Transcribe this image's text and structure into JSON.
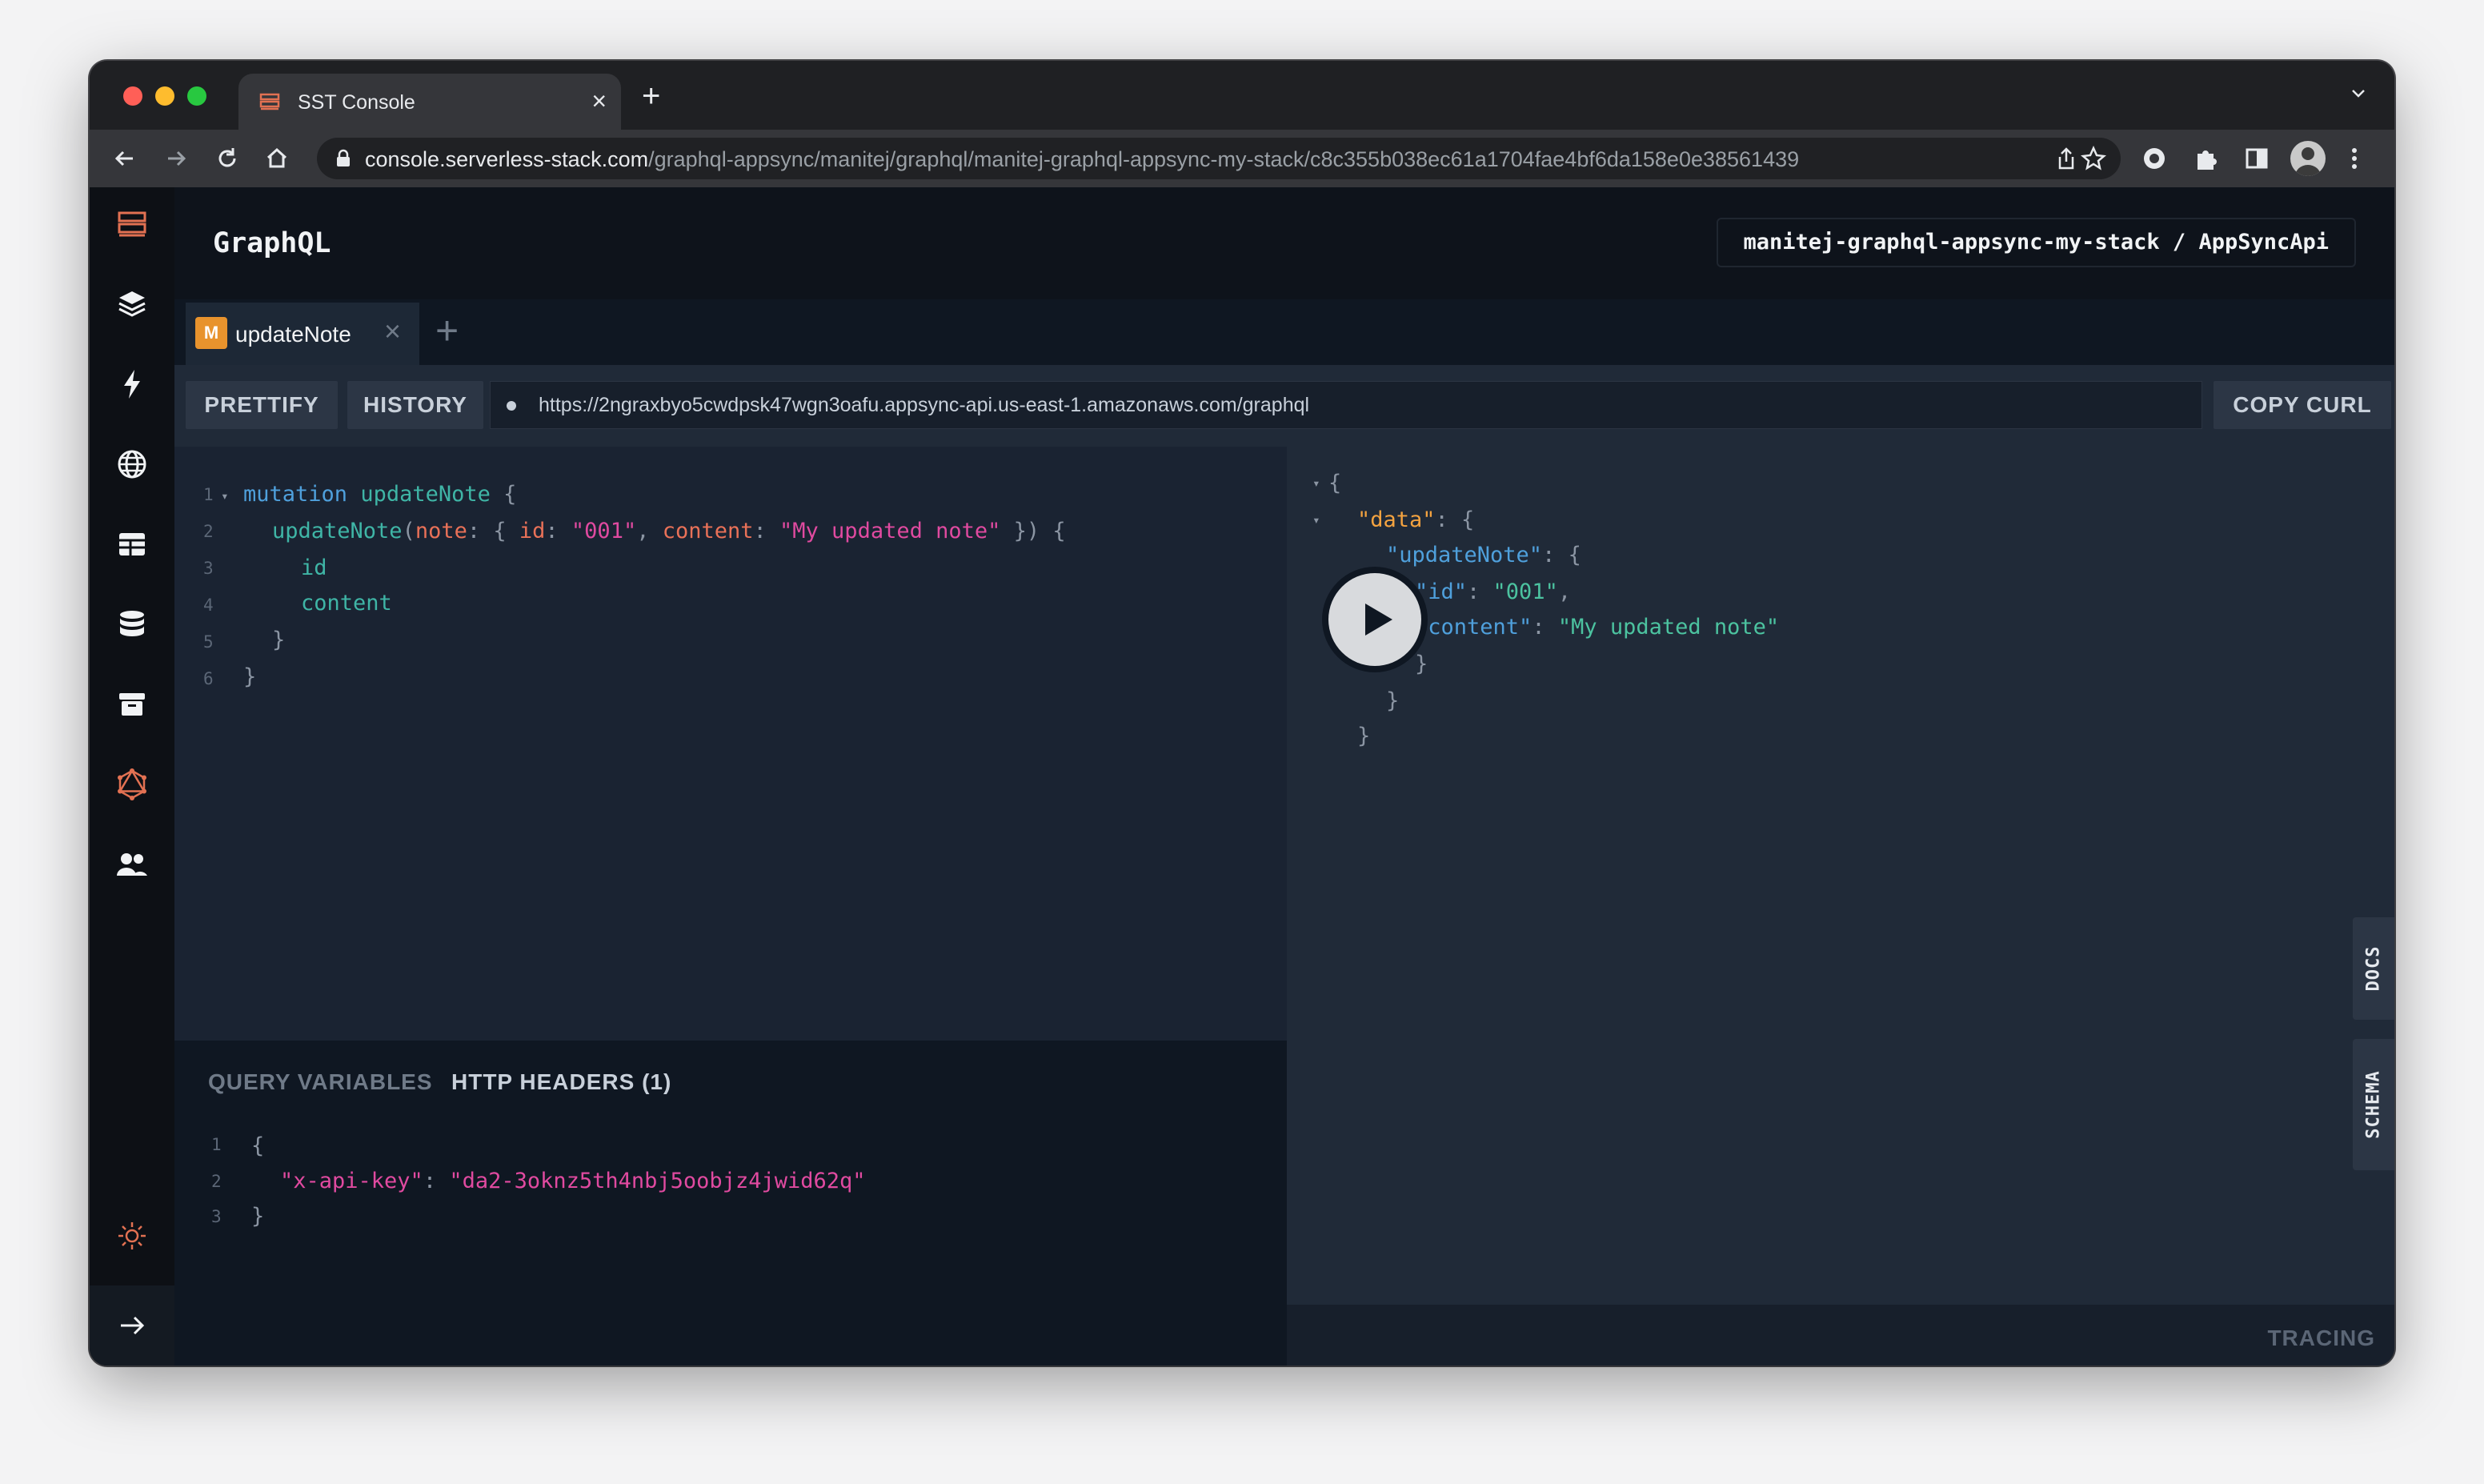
{
  "browser": {
    "tab_title": "SST Console",
    "tab_close": "×",
    "new_tab": "+",
    "url_host": "console.serverless-stack.com",
    "url_path": "/graphql-appsync/manitej/graphql/manitej-graphql-appsync-my-stack/c8c355b038ec61a1704fae4bf6da158e0e38561439"
  },
  "header": {
    "title": "GraphQL",
    "stack_path": "manitej-graphql-appsync-my-stack / AppSyncApi"
  },
  "graphiql": {
    "tab": {
      "badge": "M",
      "label": "updateNote",
      "close": "×"
    },
    "add_tab": "+",
    "prettify_label": "PRETTIFY",
    "history_label": "HISTORY",
    "endpoint": "https://2ngraxbyo5cwdpsk47wgn3oafu.appsync-api.us-east-1.amazonaws.com/graphql",
    "copy_curl_label": "COPY CURL",
    "docs_label": "DOCS",
    "schema_label": "SCHEMA",
    "tracing_label": "TRACING",
    "query_variables_label": "QUERY VARIABLES",
    "http_headers_label": "HTTP HEADERS (1)"
  },
  "query_lines": {
    "n": [
      "1",
      "2",
      "3",
      "4",
      "5",
      "6"
    ],
    "l1": {
      "kw": "mutation",
      "name": "updateNote",
      "brace": "{"
    },
    "l2": {
      "fn": "updateNote",
      "p1": "(",
      "arg1": "note",
      "p2": ": { ",
      "arg2": "id",
      "p3": ": ",
      "s1": "\"001\"",
      "p4": ", ",
      "arg3": "content",
      "p5": ": ",
      "s2": "\"My updated note\"",
      "p6": " }) {"
    },
    "l3": "id",
    "l4": "content",
    "l5": "}",
    "l6": "}"
  },
  "result_lines": {
    "open": "{",
    "data_key": "\"data\"",
    "colon_brace": ": {",
    "update_key": "\"updateNote\"",
    "id_key": "\"id\"",
    "id_val": "\"001\"",
    "comma": ",",
    "content_key": "\"content\"",
    "content_val": "\"My updated note\"",
    "colon": ": ",
    "close": "}"
  },
  "header_lines": {
    "n": [
      "1",
      "2",
      "3"
    ],
    "open": "{",
    "key": "\"x-api-key\"",
    "colon": ": ",
    "value": "\"da2-3oknz5th4nbj5oobjz4jwid62q\"",
    "close": "}"
  },
  "colors": {
    "accent": "#e8932d",
    "sst_orange": "#e27152",
    "keyword": "#4fa0dc",
    "string": "#e04aa0",
    "result_string": "#4cc3a0"
  }
}
